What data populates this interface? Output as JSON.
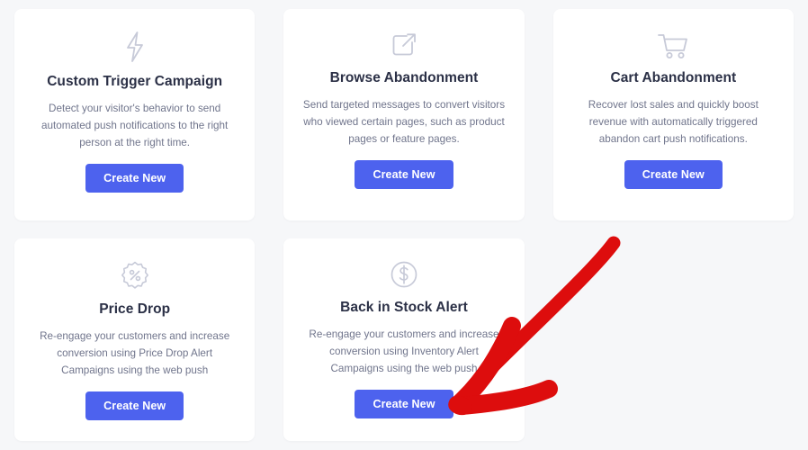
{
  "page": {
    "background_color": "#f6f7f9",
    "card_background": "#ffffff",
    "accent_color": "#4d62ee",
    "title_color": "#2b3046",
    "body_color": "#70758c",
    "icon_color": "#c7cad8",
    "annotation_color": "#dd0d0d"
  },
  "cards": [
    {
      "icon": "lightning-bolt-icon",
      "title": "Custom Trigger Campaign",
      "description": "Detect your visitor's behavior to send automated push notifications to the right person at the right time.",
      "button_label": "Create New"
    },
    {
      "icon": "external-link-icon",
      "title": "Browse Abandonment",
      "description": "Send targeted messages to convert visitors who viewed certain pages, such as product pages or feature pages.",
      "button_label": "Create New"
    },
    {
      "icon": "shopping-cart-icon",
      "title": "Cart Abandonment",
      "description": "Recover lost sales and quickly boost revenue with automatically triggered abandon cart push notifications.",
      "button_label": "Create New"
    },
    {
      "icon": "percent-badge-icon",
      "title": "Price Drop",
      "description": "Re-engage your customers and increase conversion using Price Drop Alert Campaigns using the web push",
      "button_label": "Create New"
    },
    {
      "icon": "dollar-circle-icon",
      "title": "Back in Stock Alert",
      "description": "Re-engage your customers and increase conversion using Inventory Alert Campaigns using the web push",
      "button_label": "Create New"
    }
  ],
  "annotation": {
    "name": "red-arrow-annotation",
    "points_at": "Create New",
    "color": "#dd0d0d"
  }
}
